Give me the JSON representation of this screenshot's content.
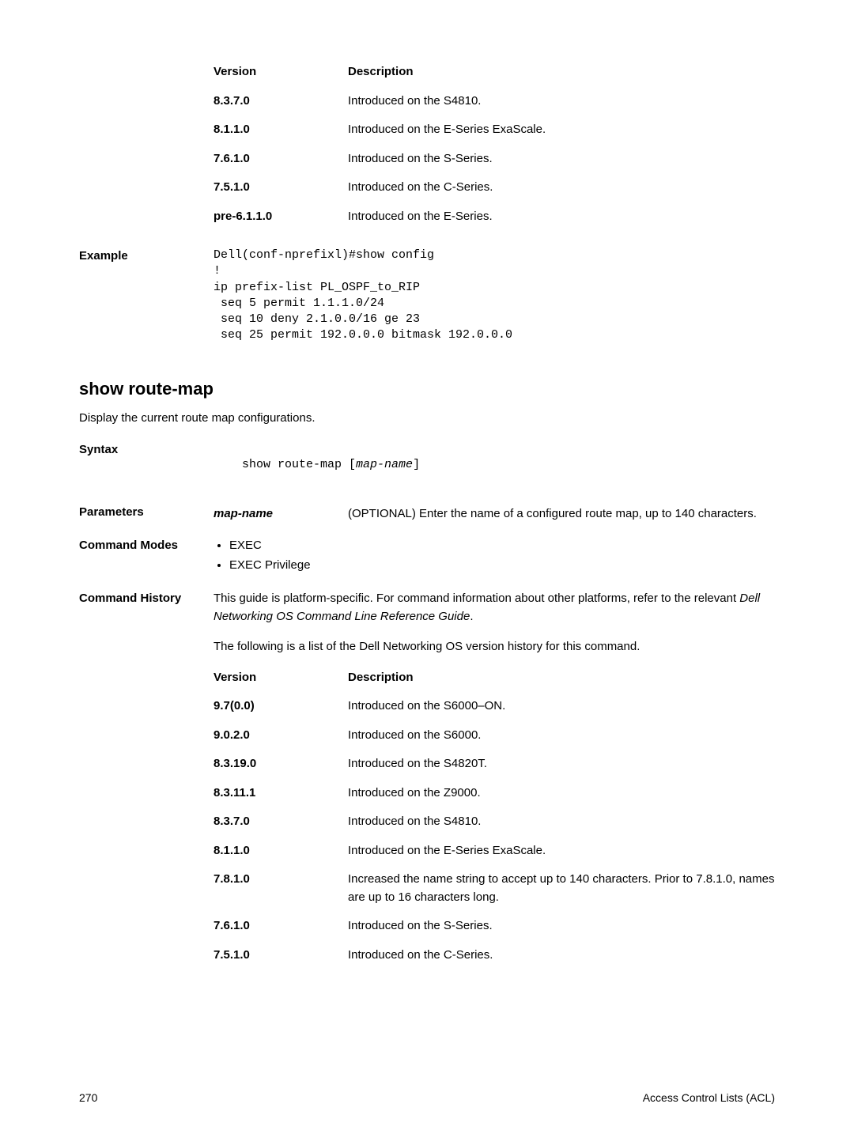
{
  "top_version_table": {
    "headers": {
      "version": "Version",
      "description": "Description"
    },
    "rows": [
      {
        "version": "8.3.7.0",
        "description": "Introduced on the S4810."
      },
      {
        "version": "8.1.1.0",
        "description": "Introduced on the E-Series ExaScale."
      },
      {
        "version": "7.6.1.0",
        "description": "Introduced on the S-Series."
      },
      {
        "version": "7.5.1.0",
        "description": "Introduced on the C-Series."
      },
      {
        "version": "pre-6.1.1.0",
        "description": "Introduced on the E-Series."
      }
    ]
  },
  "example": {
    "label": "Example",
    "code": "Dell(conf-nprefixl)#show config\n!\nip prefix-list PL_OSPF_to_RIP\n seq 5 permit 1.1.1.0/24\n seq 10 deny 2.1.0.0/16 ge 23\n seq 25 permit 192.0.0.0 bitmask 192.0.0.0"
  },
  "section": {
    "title": "show route-map",
    "intro": "Display the current route map configurations."
  },
  "syntax": {
    "label": "Syntax",
    "cmd_prefix": "show route-map [",
    "cmd_italic": "map-name",
    "cmd_suffix": "]"
  },
  "parameters": {
    "label": "Parameters",
    "name": "map-name",
    "desc": "(OPTIONAL) Enter the name of a configured route map, up to 140 characters."
  },
  "command_modes": {
    "label": "Command Modes",
    "items": [
      "EXEC",
      "EXEC Privilege"
    ]
  },
  "command_history": {
    "label": "Command History",
    "text1_pre": "This guide is platform-specific. For command information about other platforms, refer to the relevant ",
    "text1_italic": "Dell Networking OS Command Line Reference Guide",
    "text1_post": ".",
    "text2": "The following is a list of the Dell Networking OS version history for this command.",
    "headers": {
      "version": "Version",
      "description": "Description"
    },
    "rows": [
      {
        "version": "9.7(0.0)",
        "description": "Introduced on the S6000–ON."
      },
      {
        "version": "9.0.2.0",
        "description": "Introduced on the S6000."
      },
      {
        "version": "8.3.19.0",
        "description": "Introduced on the S4820T."
      },
      {
        "version": "8.3.11.1",
        "description": "Introduced on the Z9000."
      },
      {
        "version": "8.3.7.0",
        "description": "Introduced on the S4810."
      },
      {
        "version": "8.1.1.0",
        "description": "Introduced on the E-Series ExaScale."
      },
      {
        "version": "7.8.1.0",
        "description": "Increased the name string to accept up to 140 characters. Prior to 7.8.1.0, names are up to 16 characters long."
      },
      {
        "version": "7.6.1.0",
        "description": "Introduced on the S-Series."
      },
      {
        "version": "7.5.1.0",
        "description": "Introduced on the C-Series."
      }
    ]
  },
  "footer": {
    "page": "270",
    "title": "Access Control Lists (ACL)"
  }
}
